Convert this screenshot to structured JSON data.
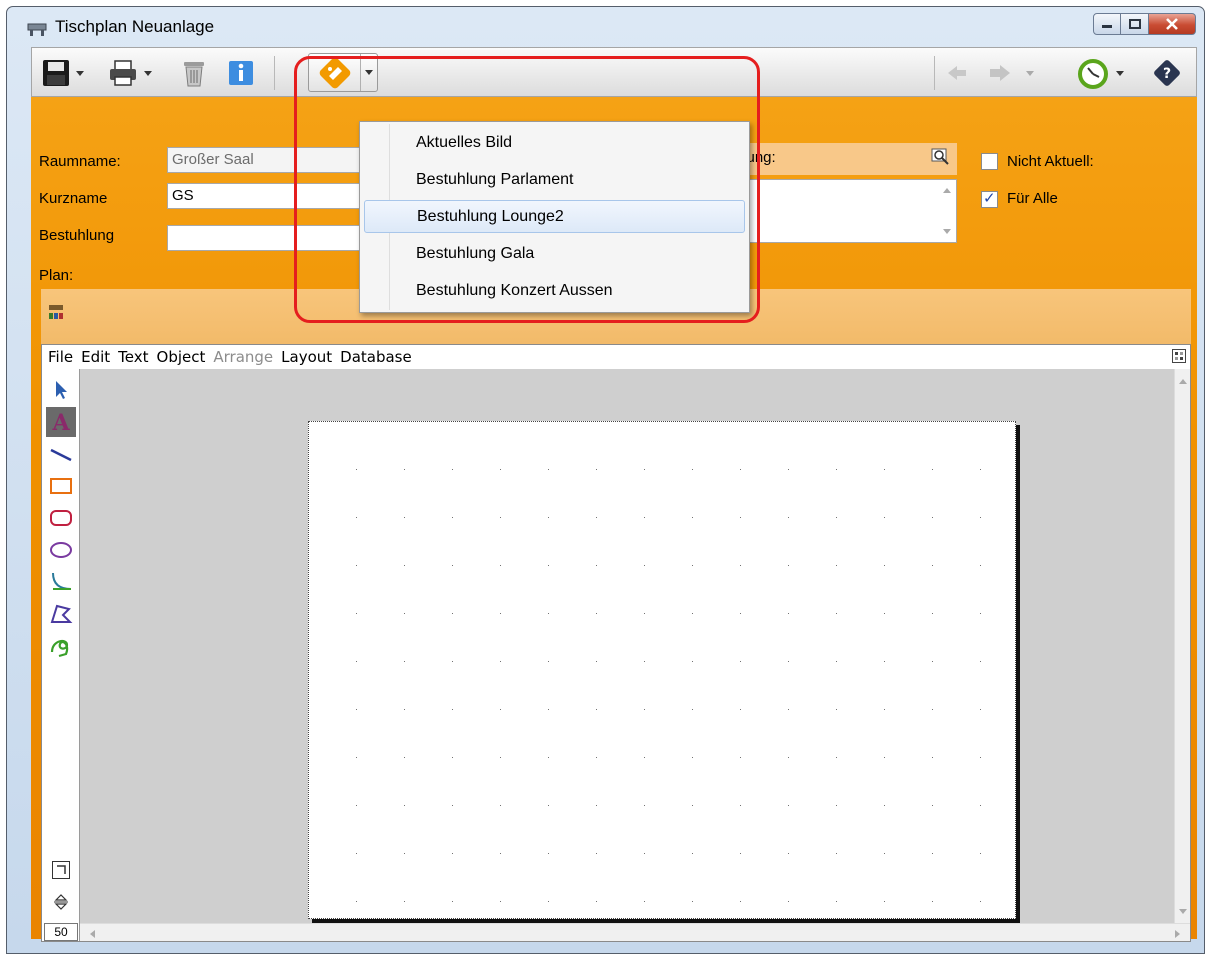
{
  "window": {
    "title": "Tischplan Neuanlage",
    "controls": {
      "minimize": "minimize",
      "maximize": "maximize",
      "close": "close"
    }
  },
  "toolbar": {
    "icons": [
      "save-icon",
      "print-icon",
      "trash-icon",
      "info-icon",
      "seating-layout-icon",
      "back-arrow-icon",
      "forward-arrow-icon",
      "timer-icon",
      "help-icon"
    ]
  },
  "form": {
    "raumname_label": "Raumname:",
    "raumname_value": "Großer Saal",
    "kurzname_label": "Kurzname",
    "kurzname_value": "GS",
    "bestuhlung_label": "Bestuhlung",
    "bestuhlung_value": "",
    "bemerkung_label_partial": "kung:",
    "nicht_aktuell_label": "Nicht Aktuell:",
    "nicht_aktuell_checked": false,
    "fuer_alle_label": "Für Alle",
    "fuer_alle_checked": true,
    "plan_label": "Plan:"
  },
  "editor": {
    "menu": [
      "File",
      "Edit",
      "Text",
      "Object",
      "Arrange",
      "Layout",
      "Database"
    ],
    "menu_disabled": [
      "Arrange"
    ],
    "zoom": "50",
    "tools": [
      "pointer-tool",
      "text-tool",
      "line-tool",
      "rectangle-tool",
      "rounded-rect-tool",
      "ellipse-tool",
      "arc-tool",
      "polygon-tool",
      "freehand-tool"
    ]
  },
  "dropdown": {
    "items": [
      {
        "label": "Aktuelles Bild",
        "highlighted": false
      },
      {
        "label": "Bestuhlung Parlament",
        "highlighted": false
      },
      {
        "label": "Bestuhlung Lounge2",
        "highlighted": true
      },
      {
        "label": "Bestuhlung Gala",
        "highlighted": false
      },
      {
        "label": "Bestuhlung Konzert Aussen",
        "highlighted": false
      }
    ]
  },
  "colors": {
    "form_orange": "#f09100",
    "annotation_red": "#e51e1e",
    "menu_highlight": "#dde9f8"
  }
}
